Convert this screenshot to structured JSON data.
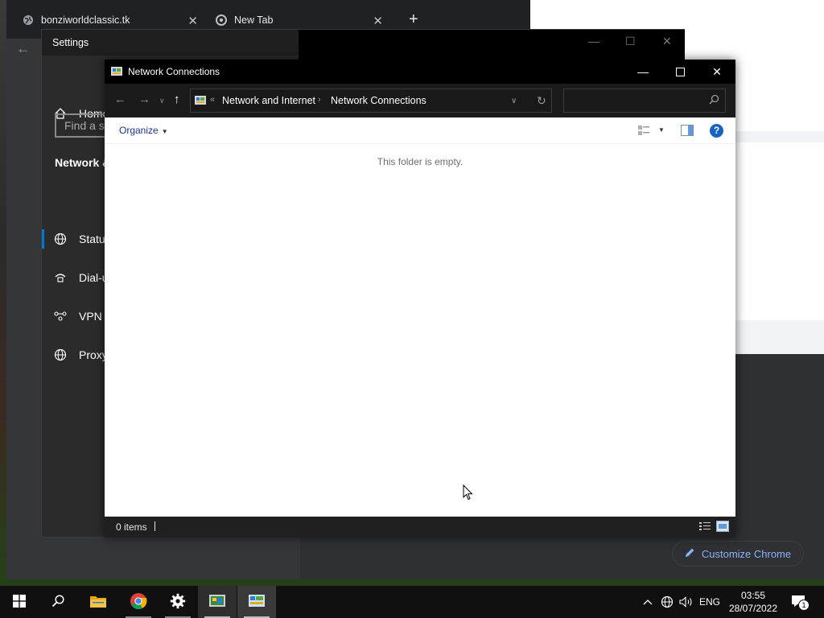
{
  "browser": {
    "tabs": [
      {
        "title": "bonziworldclassic.tk",
        "close": "✕"
      },
      {
        "title": "New Tab",
        "close": "✕"
      }
    ],
    "new_tab_label": "+",
    "customize_label": "Customize Chrome",
    "footer_text": "                "
  },
  "settings": {
    "title": "Settings",
    "home_label": "Home",
    "search_placeholder": "Find a se",
    "section_header": "Network &",
    "nav_items": [
      {
        "label": "Status",
        "icon": "globe-icon"
      },
      {
        "label": "Dial-up",
        "icon": "dialup-icon"
      },
      {
        "label": "VPN",
        "icon": "vpn-icon"
      },
      {
        "label": "Proxy",
        "icon": "globe-icon"
      }
    ]
  },
  "explorer": {
    "title": "Network Connections",
    "breadcrumb": [
      "Network and Internet",
      "Network Connections"
    ],
    "breadcrumb_overflow": "«",
    "organize_label": "Organize",
    "empty_message": "This folder is empty.",
    "status_items": "0 items",
    "help_label": "?"
  },
  "taskbar": {
    "language": "ENG",
    "time": "03:55",
    "date": "28/07/2022",
    "notification_count": "1",
    "apps": [
      "start-button",
      "search-button",
      "file-explorer",
      "chrome",
      "settings",
      "control-panel",
      "network-connections"
    ]
  },
  "colors": {
    "accent": "#0078d4",
    "chrome_link": "#8ab4f8",
    "help_blue": "#1565c0"
  }
}
